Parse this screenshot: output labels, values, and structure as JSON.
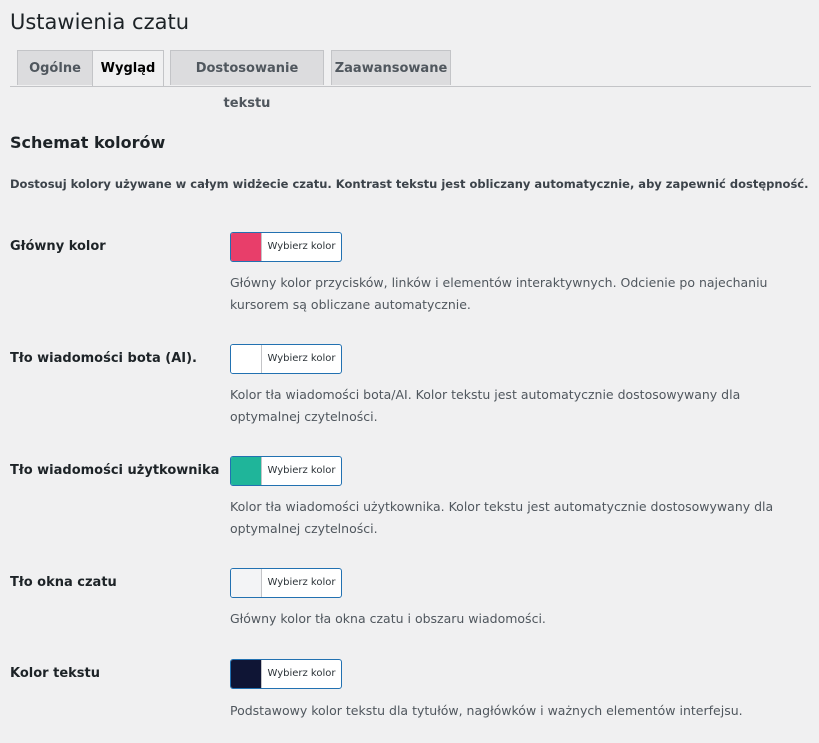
{
  "page": {
    "title": "Ustawienia czatu"
  },
  "tabs": [
    {
      "label": "Ogólne",
      "active": false
    },
    {
      "label": "Wygląd",
      "active": true
    },
    {
      "label": "Dostosowanie tekstu",
      "active": false
    },
    {
      "label": "Zaawansowane",
      "active": false
    }
  ],
  "section": {
    "title": "Schemat kolorów",
    "description": "Dostosuj kolory używane w całym widżecie czatu. Kontrast tekstu jest obliczany automatycznie, aby zapewnić dostępność."
  },
  "fields": [
    {
      "label": "Główny kolor",
      "color": "#e83e6a",
      "button_label": "Wybierz kolor",
      "description": "Główny kolor przycisków, linków i elementów interaktywnych. Odcienie po najechaniu kursorem są obliczane automatycznie."
    },
    {
      "label": "Tło wiadomości bota (AI).",
      "color": "#ffffff",
      "button_label": "Wybierz kolor",
      "description": "Kolor tła wiadomości bota/AI. Kolor tekstu jest automatycznie dostosowywany dla optymalnej czytelności."
    },
    {
      "label": "Tło wiadomości użytkownika",
      "color": "#1fb59a",
      "button_label": "Wybierz kolor",
      "description": "Kolor tła wiadomości użytkownika. Kolor tekstu jest automatycznie dostosowywany dla optymalnej czytelności."
    },
    {
      "label": "Tło okna czatu",
      "color": "#f3f4f6",
      "button_label": "Wybierz kolor",
      "description": "Główny kolor tła okna czatu i obszaru wiadomości."
    },
    {
      "label": "Kolor tekstu",
      "color": "#0f1535",
      "button_label": "Wybierz kolor",
      "description": "Podstawowy kolor tekstu dla tytułów, nagłówków i ważnych elementów interfejsu."
    }
  ]
}
